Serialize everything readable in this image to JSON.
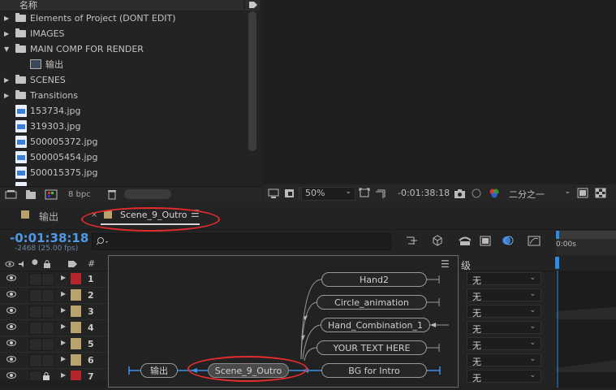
{
  "project": {
    "column_header": "名称",
    "items": [
      {
        "label": "Elements of Project (DONT EDIT)",
        "type": "folder",
        "expanded": false
      },
      {
        "label": "IMAGES",
        "type": "folder",
        "expanded": false
      },
      {
        "label": "MAIN COMP FOR RENDER",
        "type": "folder",
        "expanded": true
      },
      {
        "label": "输出",
        "type": "comp",
        "indent": true
      },
      {
        "label": "SCENES",
        "type": "folder",
        "expanded": false
      },
      {
        "label": "Transitions",
        "type": "folder",
        "expanded": false
      },
      {
        "label": "153734.jpg",
        "type": "jpg"
      },
      {
        "label": "319303.jpg",
        "type": "jpg"
      },
      {
        "label": "500005372.jpg",
        "type": "jpg"
      },
      {
        "label": "500005454.jpg",
        "type": "jpg"
      },
      {
        "label": "500015375.jpg",
        "type": "jpg"
      }
    ],
    "bit_depth": "8 bpc"
  },
  "viewer": {
    "zoom": "50%",
    "timecode": "-0:01:38:18",
    "resolution": "二分之一"
  },
  "timeline": {
    "tabs": [
      {
        "label": "输出",
        "color": "#b8a36f"
      },
      {
        "label": "Scene_9_Outro",
        "color": "#b8a36f",
        "active": true
      }
    ],
    "timecode": "-0:01:38:18",
    "frames_fps": "-2468 (25.00 fps)",
    "search_placeholder": "",
    "columns": {
      "number": "#",
      "parent": "级"
    },
    "ruler_start": "0:00s",
    "layers": [
      {
        "num": "1",
        "color": "#b3262c",
        "lock": false
      },
      {
        "num": "2",
        "color": "#b8a36f",
        "lock": false
      },
      {
        "num": "3",
        "color": "#b8a36f",
        "lock": false
      },
      {
        "num": "4",
        "color": "#b8a36f",
        "lock": false
      },
      {
        "num": "5",
        "color": "#b8a36f",
        "lock": false
      },
      {
        "num": "6",
        "color": "#b8a36f",
        "lock": false
      },
      {
        "num": "7",
        "color": "#b3262c",
        "lock": true
      }
    ],
    "parent_value": "无"
  },
  "flowchart": {
    "nodes_right": [
      "Hand2",
      "Circle_animation",
      "Hand_Combination_1",
      "YOUR TEXT HERE",
      "BG for Intro"
    ],
    "center": "Scene_9_Outro",
    "left": "输出"
  },
  "annotation_color": "#e32c2c"
}
